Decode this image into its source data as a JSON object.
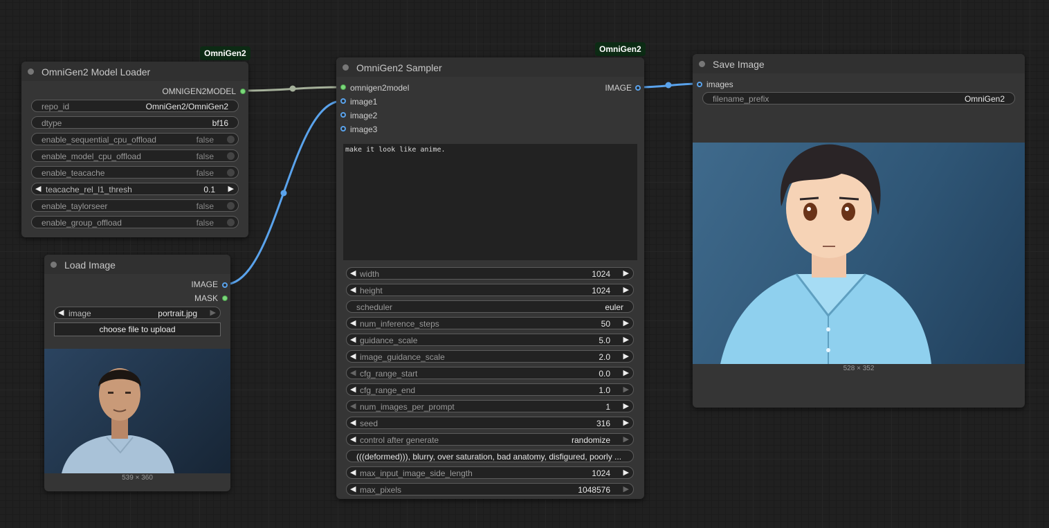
{
  "badges": {
    "loader": "OmniGen2",
    "sampler": "OmniGen2"
  },
  "loader": {
    "title": "OmniGen2 Model Loader",
    "output": "OMNIGEN2MODEL",
    "widgets": [
      {
        "label": "repo_id",
        "value": "OmniGen2/OmniGen2"
      },
      {
        "label": "dtype",
        "value": "bf16"
      },
      {
        "label": "enable_sequential_cpu_offload",
        "value": "false"
      },
      {
        "label": "enable_model_cpu_offload",
        "value": "false"
      },
      {
        "label": "enable_teacache",
        "value": "false"
      },
      {
        "label": "teacache_rel_l1_thresh",
        "value": "0.1"
      },
      {
        "label": "enable_taylorseer",
        "value": "false"
      },
      {
        "label": "enable_group_offload",
        "value": "false"
      }
    ]
  },
  "load_image": {
    "title": "Load Image",
    "outputs": [
      "IMAGE",
      "MASK"
    ],
    "image_label": "image",
    "image_value": "portrait.jpg",
    "upload_label": "choose file to upload",
    "caption": "539 × 360"
  },
  "sampler": {
    "title": "OmniGen2 Sampler",
    "inputs": [
      "omnigen2model",
      "image1",
      "image2",
      "image3"
    ],
    "output": "IMAGE",
    "prompt": "make it look like anime.",
    "widgets": [
      {
        "label": "width",
        "value": "1024"
      },
      {
        "label": "height",
        "value": "1024"
      },
      {
        "label": "scheduler",
        "value": "euler"
      },
      {
        "label": "num_inference_steps",
        "value": "50"
      },
      {
        "label": "guidance_scale",
        "value": "5.0"
      },
      {
        "label": "image_guidance_scale",
        "value": "2.0"
      },
      {
        "label": "cfg_range_start",
        "value": "0.0"
      },
      {
        "label": "cfg_range_end",
        "value": "1.0"
      },
      {
        "label": "num_images_per_prompt",
        "value": "1"
      },
      {
        "label": "seed",
        "value": "316"
      },
      {
        "label": "control after generate",
        "value": "randomize"
      },
      {
        "label": "negative_prompt",
        "value": "(((deformed))), blurry, over saturation, bad anatomy, disfigured, poorly ..."
      },
      {
        "label": "max_input_image_side_length",
        "value": "1024"
      },
      {
        "label": "max_pixels",
        "value": "1048576"
      }
    ]
  },
  "save": {
    "title": "Save Image",
    "input": "images",
    "prefix_label": "filename_prefix",
    "prefix_value": "OmniGen2",
    "caption": "528 × 352"
  },
  "colors": {
    "model_link": "#a5b09a",
    "image_link": "#5aa3ec",
    "badge_bg": "#0c2b14"
  }
}
